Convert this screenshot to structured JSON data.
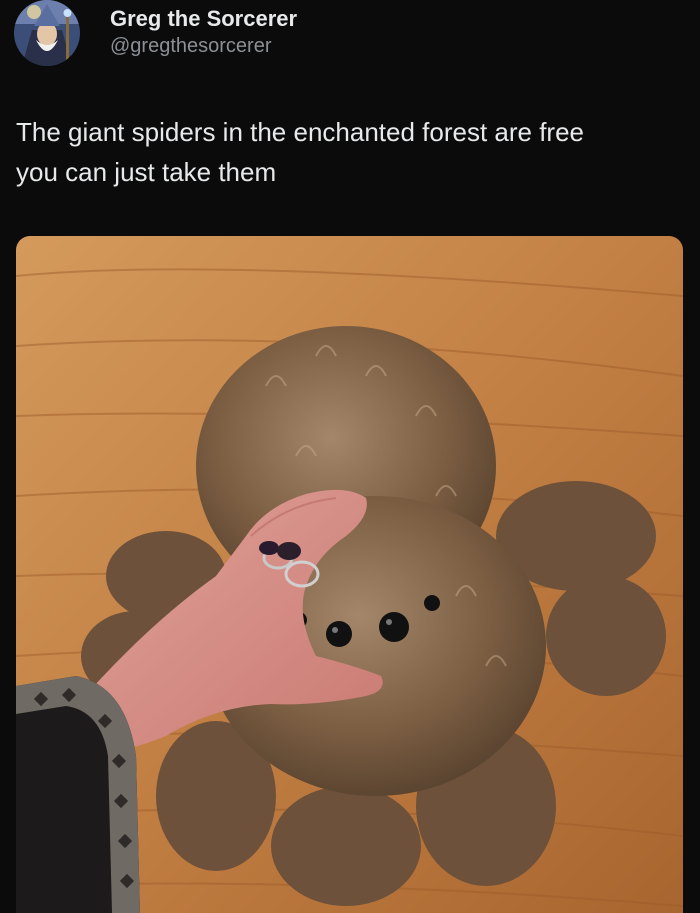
{
  "tweet": {
    "author": {
      "display_name": "Greg the Sorcerer",
      "handle": "@gregthesorcerer"
    },
    "text_line1": "The giant spiders in the enchanted forest are free",
    "text_line2": "you can just take them"
  },
  "media": {
    "subject": "plush-spider-photo"
  },
  "colors": {
    "background": "#0b0b0c",
    "primary_text": "#e7e9ea",
    "secondary_text": "#8b9096",
    "wood_floor": "#c78a4e",
    "fur": "#8a6a4c",
    "skin": "#d98f86"
  }
}
